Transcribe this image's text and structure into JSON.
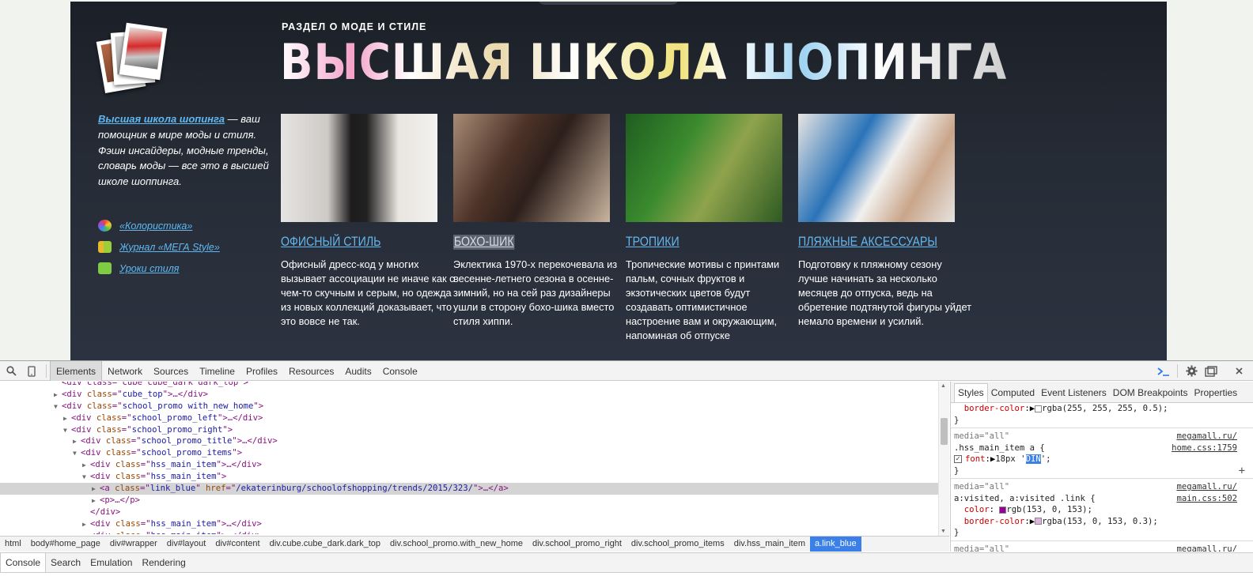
{
  "page": {
    "section_label": "РАЗДЕЛ О МОДЕ И СТИЛЕ",
    "title": "ВЫСШАЯ ШКОЛА ШОПИНГА",
    "intro_link": "Высшая школа шопинга",
    "intro_text": " — ваш помощник в мире моды и стиля. Фэшн инсайдеры, модные тренды, словарь моды — все это в высшей школе шоппинга.",
    "side_links": [
      {
        "label": "«Колористика»",
        "icon": "color-wheel-icon"
      },
      {
        "label": "Журнал «МЕГА Style»",
        "icon": "journal-icon"
      },
      {
        "label": "Уроки стиля",
        "icon": "glasses-icon"
      }
    ],
    "items": [
      {
        "title": "ОФИСНЫЙ СТИЛЬ",
        "text": "Офисный дресс-код у многих вызывает ассоциации не иначе как с чем-то скучным и серым, но одежда из новых коллекций доказывает, что это вовсе не так."
      },
      {
        "title": "БОХО-ШИК",
        "text": "Эклектика 1970-х перекочевала из весенне-летнего сезона в осенне-зимний, но на сей раз дизайнеры ушли в сторону бохо-шика вместо стиля хиппи."
      },
      {
        "title": "ТРОПИКИ",
        "text": "Тропические мотивы с принтами пальм, сочных фруктов и экзотических цветов будут создавать оптимистичное настроение вам и окружающим, напоминая об отпуске"
      },
      {
        "title": "ПЛЯЖНЫЕ АКСЕССУАРЫ",
        "text": "Подготовку к пляжному сезону лучше начинать за несколько месяцев до отпуска, ведь на обретение подтянутой фигуры уйдет немало времени и усилий."
      }
    ]
  },
  "devtools": {
    "tabs": [
      "Elements",
      "Network",
      "Sources",
      "Timeline",
      "Profiles",
      "Resources",
      "Audits",
      "Console"
    ],
    "active_tab": "Elements",
    "dom_lines": [
      {
        "indent": 6,
        "tri": "",
        "html": "<div class=\"cube cube_dark dark_top\">",
        "cut": true
      },
      {
        "indent": 6,
        "tri": "▶",
        "tag": "div",
        "attrs": [
          [
            "class",
            "cube_top"
          ]
        ],
        "tail": "…</div>"
      },
      {
        "indent": 6,
        "tri": "▼",
        "tag": "div",
        "attrs": [
          [
            "class",
            "school_promo with_new_home"
          ]
        ],
        "tail": ""
      },
      {
        "indent": 7,
        "tri": "▶",
        "tag": "div",
        "attrs": [
          [
            "class",
            "school_promo_left"
          ]
        ],
        "tail": "…</div>"
      },
      {
        "indent": 7,
        "tri": "▼",
        "tag": "div",
        "attrs": [
          [
            "class",
            "school_promo_right"
          ]
        ],
        "tail": ""
      },
      {
        "indent": 8,
        "tri": "▶",
        "tag": "div",
        "attrs": [
          [
            "class",
            "school_promo_title"
          ]
        ],
        "tail": "…</div>"
      },
      {
        "indent": 8,
        "tri": "▼",
        "tag": "div",
        "attrs": [
          [
            "class",
            "school_promo_items"
          ]
        ],
        "tail": ""
      },
      {
        "indent": 9,
        "tri": "▶",
        "tag": "div",
        "attrs": [
          [
            "class",
            "hss_main_item"
          ]
        ],
        "tail": "…</div>"
      },
      {
        "indent": 9,
        "tri": "▼",
        "tag": "div",
        "attrs": [
          [
            "class",
            "hss_main_item"
          ]
        ],
        "tail": ""
      },
      {
        "indent": 10,
        "tri": "▶",
        "tag": "a",
        "attrs": [
          [
            "class",
            "link_blue"
          ],
          [
            "href",
            "/ekaterinburg/schoolofshopping/trends/2015/323/"
          ]
        ],
        "tail": "…</a>",
        "selected": true
      },
      {
        "indent": 10,
        "tri": "▶",
        "tag": "p",
        "attrs": [],
        "tail": "…</p>"
      },
      {
        "indent": 9,
        "tri": "",
        "closing": "</div>"
      },
      {
        "indent": 9,
        "tri": "▶",
        "tag": "div",
        "attrs": [
          [
            "class",
            "hss_main_item"
          ]
        ],
        "tail": "…</div>"
      },
      {
        "indent": 9,
        "tri": "▶",
        "tag": "div",
        "attrs": [
          [
            "class",
            "hss_main_item"
          ]
        ],
        "tail": "…</div>"
      }
    ],
    "breadcrumbs": [
      "html",
      "body#home_page",
      "div#wrapper",
      "div#layout",
      "div#content",
      "div.cube.cube_dark.dark_top",
      "div.school_promo.with_new_home",
      "div.school_promo_right",
      "div.school_promo_items",
      "div.hss_main_item",
      "a.link_blue"
    ],
    "styles_tabs": [
      "Styles",
      "Computed",
      "Event Listeners",
      "DOM Breakpoints",
      "Properties"
    ],
    "rules": {
      "top_prop": "border-color",
      "top_value": "rgba(255, 255, 255, 0.5);",
      "r1_media": "media=\"all\"",
      "r1_src_a": "megamall.ru/",
      "r1_selector": ".hss_main_item a {",
      "r1_src_b": "home.css:1759",
      "r1_prop": "font",
      "r1_value_a": "18px '",
      "r1_value_hl": "DIN",
      "r1_value_b": "';",
      "r2_media": "media=\"all\"",
      "r2_src_a": "megamall.ru/",
      "r2_selector": "a:visited, a:visited .link {",
      "r2_src_b": "main.css:502",
      "r2_prop1": "color",
      "r2_val1": "rgb(153, 0, 153);",
      "r2_prop2": "border-color",
      "r2_val2": "rgba(153, 0, 153, 0.3);",
      "r3_media": "media=\"all\"",
      "r3_src_a": "megamall.ru/",
      "close_brace": "}"
    },
    "drawer_tabs": [
      "Console",
      "Search",
      "Emulation",
      "Rendering"
    ],
    "colors": {
      "accent": "#3a80e8",
      "link": "#5fb8f2",
      "visited_swatch": "#990099"
    }
  }
}
